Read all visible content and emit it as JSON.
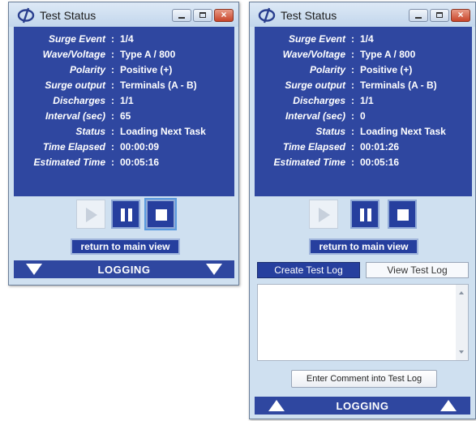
{
  "windows": [
    {
      "title": "Test Status",
      "fields": [
        {
          "label": "Surge Event",
          "value": "1/4"
        },
        {
          "label": "Wave/Voltage",
          "value": "Type A / 800"
        },
        {
          "label": "Polarity",
          "value": "Positive (+)"
        },
        {
          "label": "Surge output",
          "value": "Terminals (A - B)"
        },
        {
          "label": "Discharges",
          "value": "1/1"
        },
        {
          "label": "Interval (sec)",
          "value": "65"
        },
        {
          "label": "Status",
          "value": "Loading Next Task"
        },
        {
          "label": "Time Elapsed",
          "value": "00:00:09"
        },
        {
          "label": "Estimated Time",
          "value": "00:05:16"
        }
      ],
      "separator": ":",
      "return_label": "return to main view",
      "logging_label": "LOGGING"
    },
    {
      "title": "Test Status",
      "fields": [
        {
          "label": "Surge Event",
          "value": "1/4"
        },
        {
          "label": "Wave/Voltage",
          "value": "Type A / 800"
        },
        {
          "label": "Polarity",
          "value": "Positive (+)"
        },
        {
          "label": "Surge output",
          "value": "Terminals (A - B)"
        },
        {
          "label": "Discharges",
          "value": "1/1"
        },
        {
          "label": "Interval (sec)",
          "value": "0"
        },
        {
          "label": "Status",
          "value": "Loading Next Task"
        },
        {
          "label": "Time Elapsed",
          "value": "00:01:26"
        },
        {
          "label": "Estimated Time",
          "value": "00:05:16"
        }
      ],
      "separator": ":",
      "return_label": "return to main view",
      "create_log_label": "Create Test Log",
      "view_log_label": "View Test Log",
      "log_text": "",
      "enter_comment_label": "Enter Comment into Test Log",
      "logging_label": "LOGGING"
    }
  ],
  "icons": {
    "logo": "phi-logo-icon",
    "minimize": "minimize-icon",
    "maximize": "maximize-icon",
    "close": "close-icon",
    "play": "play-icon",
    "pause": "pause-icon",
    "stop": "stop-icon",
    "collapse_arrows": "down-arrow-icon",
    "expand_arrows": "up-arrow-icon"
  },
  "colors": {
    "panel_blue": "#2f47a0",
    "window_frame": "#cfe0f0",
    "button_blue": "#263f9e"
  }
}
